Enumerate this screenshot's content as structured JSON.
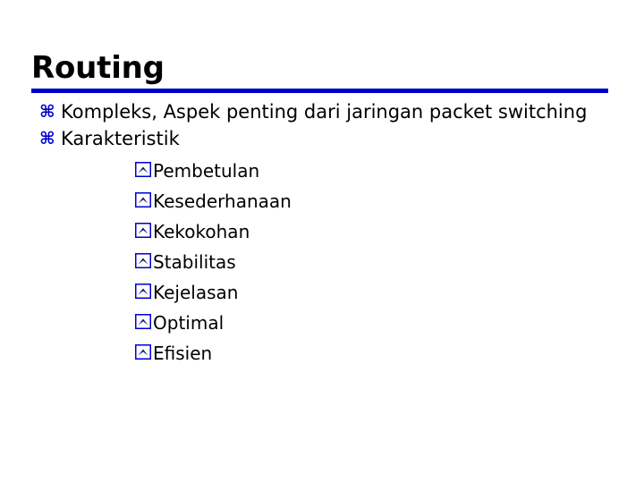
{
  "slide": {
    "title": "Routing",
    "accent_color": "#0000CC",
    "text_color": "#000000",
    "background_color": "#FFFFFF",
    "rule": {
      "name": "title-underline-rule",
      "color": "#0000CC"
    },
    "bullets": {
      "level1_glyph": "⌘",
      "level1_glyph_name": "command-bullet-icon",
      "level2_glyph_name": "caret-box-bullet-icon",
      "level2_box_border_color": "#0000CC",
      "level2_caret_color": "#111177"
    },
    "items": [
      {
        "level": 1,
        "text": "Kompleks, Aspek penting dari jaringan packet switching",
        "children": []
      },
      {
        "level": 1,
        "text": "Karakteristik",
        "children": [
          {
            "level": 2,
            "text": "Pembetulan"
          },
          {
            "level": 2,
            "text": "Kesederhanaan"
          },
          {
            "level": 2,
            "text": "Kekokohan"
          },
          {
            "level": 2,
            "text": "Stabilitas"
          },
          {
            "level": 2,
            "text": "Kejelasan"
          },
          {
            "level": 2,
            "text": "Optimal"
          },
          {
            "level": 2,
            "text": "Efisien"
          }
        ]
      }
    ]
  }
}
